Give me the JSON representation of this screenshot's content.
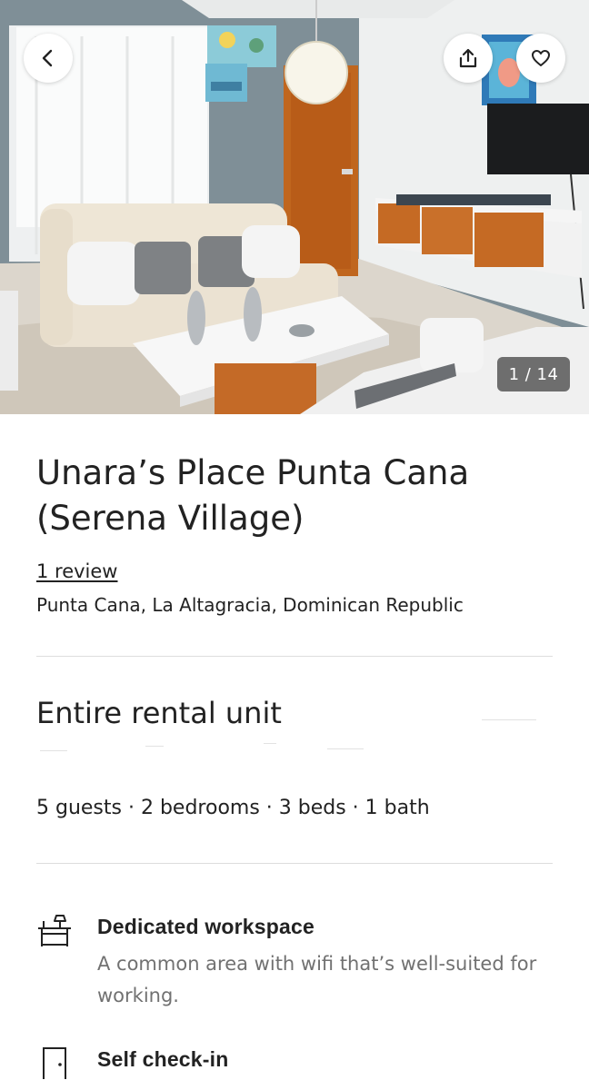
{
  "gallery": {
    "counter": "1 / 14"
  },
  "icons": {
    "back": "chevron-left-icon",
    "share": "share-icon",
    "save": "heart-icon",
    "workspace": "desk-icon",
    "checkin": "door-icon"
  },
  "listing": {
    "title": "Unara’s Place Punta Cana (Serena Village)",
    "reviews_link": "1 review",
    "location": "Punta Cana, La Altagracia, Dominican Republic",
    "type": "Entire rental unit",
    "capacity": "5 guests · 2 bedrooms · 3 beds · 1 bath"
  },
  "amenities": [
    {
      "title": "Dedicated workspace",
      "description": "A common area with wifi that’s well-suited for working."
    },
    {
      "title": "Self check-in"
    }
  ],
  "colors": {
    "text": "#222222",
    "secondary_text": "#717171",
    "divider": "#dddddd"
  }
}
